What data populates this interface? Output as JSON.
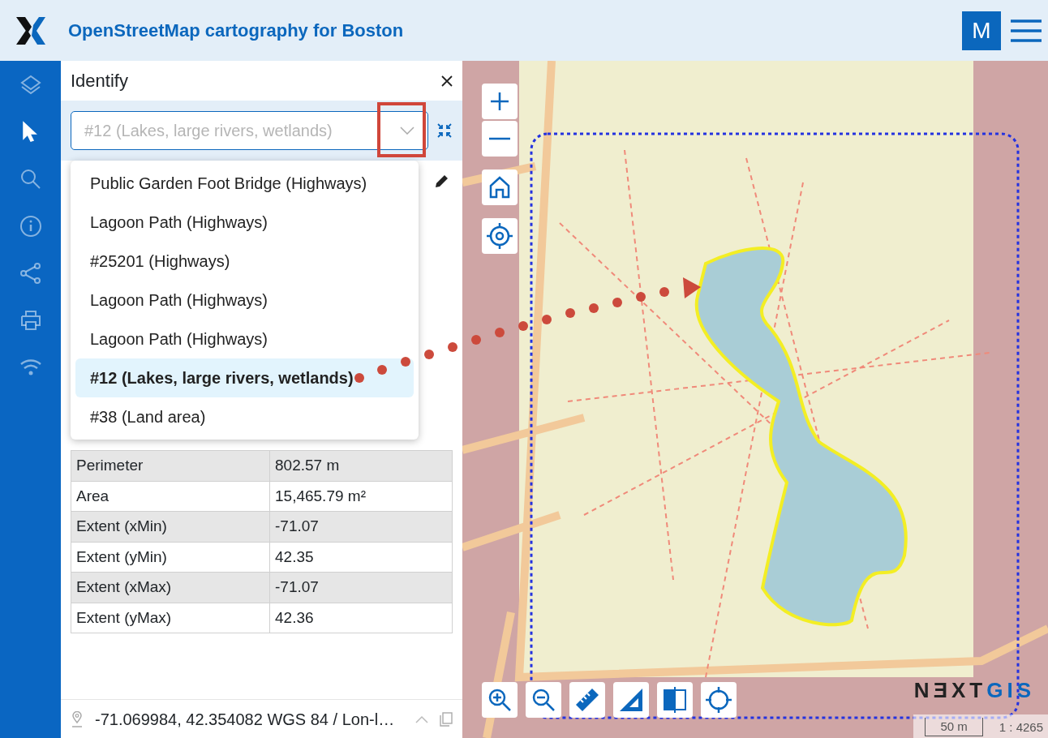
{
  "header": {
    "title": "OpenStreetMap cartography for Boston",
    "user_initial": "M"
  },
  "sidebar": {
    "items": [
      {
        "selected": false
      },
      {
        "selected": true
      },
      {
        "selected": false
      },
      {
        "selected": false
      },
      {
        "selected": false
      },
      {
        "selected": false
      },
      {
        "selected": false
      }
    ]
  },
  "identify": {
    "title": "Identify",
    "select": {
      "placeholder": "#12 (Lakes, large rivers, wetlands)"
    },
    "options": [
      {
        "label": "Public Garden Foot Bridge (Highways)",
        "selected": false
      },
      {
        "label": "Lagoon Path (Highways)",
        "selected": false
      },
      {
        "label": "#25201 (Highways)",
        "selected": false
      },
      {
        "label": "Lagoon Path (Highways)",
        "selected": false
      },
      {
        "label": "Lagoon Path (Highways)",
        "selected": false
      },
      {
        "label": "#12 (Lakes, large rivers, wetlands)",
        "selected": true
      },
      {
        "label": "#38 (Land area)",
        "selected": false
      }
    ],
    "attributes": [
      {
        "name": "Perimeter",
        "value": "802.57 m"
      },
      {
        "name": "Area",
        "value": "15,465.79 m²"
      },
      {
        "name": "Extent (xMin)",
        "value": "-71.07"
      },
      {
        "name": "Extent (yMin)",
        "value": "42.35"
      },
      {
        "name": "Extent (xMax)",
        "value": "-71.07"
      },
      {
        "name": "Extent (yMax)",
        "value": "42.36"
      }
    ]
  },
  "status_bar": {
    "coordinates": "-71.069984, 42.354082 WGS 84 / Lon-l…"
  },
  "map": {
    "logo": {
      "part_1": "NƎXT",
      "part_2": "GIS"
    },
    "scale": "50 m",
    "ratio": "1 : 4265"
  }
}
